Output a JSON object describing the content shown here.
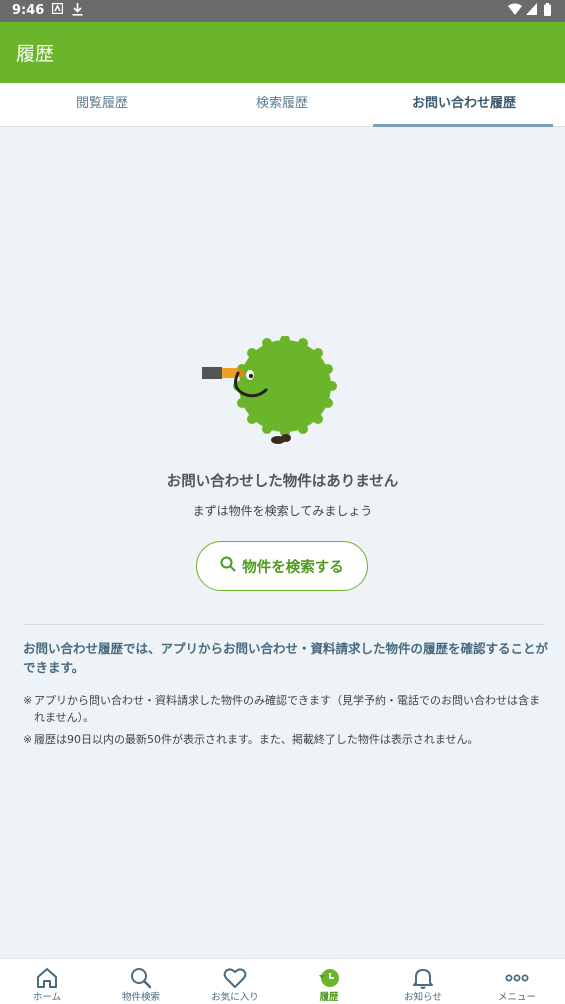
{
  "status_bar": {
    "time": "9:46"
  },
  "app_bar": {
    "title": "履歴"
  },
  "tabs": [
    {
      "label": "閲覧履歴",
      "active": false
    },
    {
      "label": "検索履歴",
      "active": false
    },
    {
      "label": "お問い合わせ履歴",
      "active": true
    }
  ],
  "empty_state": {
    "title": "お問い合わせした物件はありません",
    "subtitle": "まずは物件を検索してみましょう",
    "search_button": "物件を検索する"
  },
  "info": {
    "heading": "お問い合わせ履歴では、アプリからお問い合わせ・資料請求した物件の履歴を確認することができます。",
    "note_mark": "※",
    "notes": [
      "アプリから問い合わせ・資料請求した物件のみ確認できます（見学予約・電話でのお問い合わせは含まれません）。",
      "履歴は90日以内の最新50件が表示されます。また、掲載終了した物件は表示されません。"
    ]
  },
  "bottom_nav": [
    {
      "label": "ホーム",
      "icon": "home-icon"
    },
    {
      "label": "物件検索",
      "icon": "search-icon"
    },
    {
      "label": "お気に入り",
      "icon": "heart-icon"
    },
    {
      "label": "履歴",
      "icon": "history-icon",
      "active": true
    },
    {
      "label": "お知らせ",
      "icon": "bell-icon"
    },
    {
      "label": "メニュー",
      "icon": "more-icon"
    }
  ],
  "colors": {
    "brand_green": "#6bb52a",
    "tab_underline": "#7c9fb5",
    "background": "#eef3f7"
  }
}
